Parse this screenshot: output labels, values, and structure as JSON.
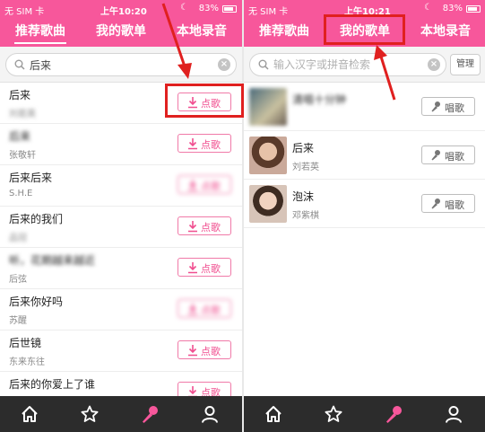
{
  "colors": {
    "accent": "#f7579b",
    "nav_bg": "#2c2c2c",
    "highlight": "#e0201f",
    "button_text": "#f04e8f"
  },
  "left": {
    "status": {
      "carrier": "无 SIM 卡 ",
      "time": "上午10:20",
      "battery": "83%"
    },
    "tabs": [
      {
        "label": "推荐歌曲"
      },
      {
        "label": "我的歌单"
      },
      {
        "label": "本地录音"
      }
    ],
    "search": {
      "value": "后来",
      "placeholder": ""
    },
    "songs": [
      {
        "title": "后来",
        "artist": "刘若英",
        "button": "点歌",
        "title_blur": false,
        "artist_blur": true,
        "button_blur": false
      },
      {
        "title": "后来",
        "artist": "张敬轩",
        "button": "点歌",
        "title_blur": true,
        "artist_blur": false,
        "button_blur": false
      },
      {
        "title": "后来后来",
        "artist": "S.H.E",
        "button": "点歌",
        "title_blur": false,
        "artist_blur": false,
        "button_blur": true
      },
      {
        "title": "后来的我们",
        "artist": "品冠",
        "button": "点歌",
        "title_blur": false,
        "artist_blur": true,
        "button_blur": false
      },
      {
        "title": "听，花期越来越近",
        "artist": "后弦",
        "button": "点歌",
        "title_blur": true,
        "artist_blur": false,
        "button_blur": false
      },
      {
        "title": "后来你好吗",
        "artist": "苏醒",
        "button": "点歌",
        "title_blur": false,
        "artist_blur": false,
        "button_blur": true
      },
      {
        "title": "后世镜",
        "artist": "东来东往",
        "button": "点歌",
        "title_blur": false,
        "artist_blur": false,
        "button_blur": false
      },
      {
        "title": "后来的你爱上了谁",
        "artist": "",
        "button": "点歌",
        "title_blur": false,
        "artist_blur": false,
        "button_blur": false
      }
    ]
  },
  "right": {
    "status": {
      "carrier": "无 SIM 卡 ",
      "time": "上午10:21",
      "battery": "83%"
    },
    "tabs": [
      {
        "label": "推荐歌曲"
      },
      {
        "label": "我的歌单"
      },
      {
        "label": "本地录音"
      }
    ],
    "search": {
      "value": "",
      "placeholder": "输入汉字或拼音检索"
    },
    "manage_label": "管理",
    "songs": [
      {
        "title": "清唱十分钟",
        "artist": "",
        "button": "唱歌",
        "blur": true
      },
      {
        "title": "后来",
        "artist": "刘若英",
        "button": "唱歌",
        "blur": false
      },
      {
        "title": "泡沫",
        "artist": "邓紫棋",
        "button": "唱歌",
        "blur": false
      }
    ]
  },
  "nav_icons": [
    "home-icon",
    "star-icon",
    "microphone-icon",
    "user-icon"
  ]
}
